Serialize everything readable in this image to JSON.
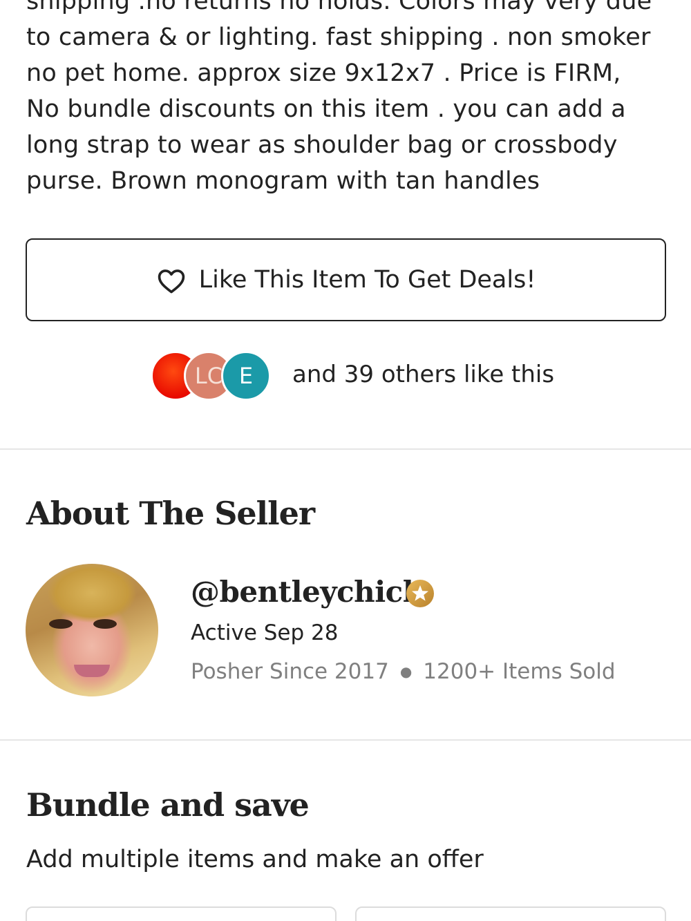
{
  "description": {
    "lines": [
      "shipping .no returns no holds.  Colors may very due",
      "to camera & or lighting. fast shipping . non smoker",
      "no pet home.  approx size 9x12x7 .  Price is FIRM,",
      "No bundle discounts on this item .  you can add a",
      "long strap to wear as shoulder bag or crossbody",
      "purse. Brown monogram with tan handles"
    ]
  },
  "like_button": {
    "label": "Like This Item To Get Deals!",
    "icon": "heart-outline-icon"
  },
  "likers": {
    "avatars": [
      "",
      "LC",
      "E"
    ],
    "text": "and 39 others like this",
    "colors": [
      "#f01a00",
      "#d9816b",
      "#1b9aa8"
    ]
  },
  "about_seller": {
    "title": "About The Seller",
    "username": "@bentleychick",
    "badge_icon": "ambassador-star-icon",
    "active": "Active Sep 28",
    "posher_since": "Posher Since 2017",
    "items_sold": "1200+ Items Sold"
  },
  "bundle": {
    "title": "Bundle and save",
    "subtitle": "Add multiple items and make an offer"
  },
  "colors": {
    "text": "#222222",
    "muted": "#7f7f7f",
    "divider": "#e6e6e6",
    "badge_gold": "#d4a24a"
  }
}
